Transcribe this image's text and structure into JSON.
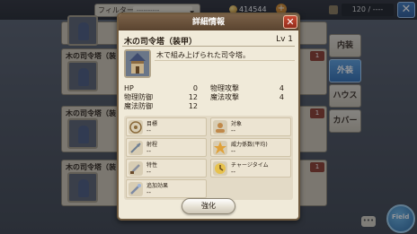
{
  "topbar": {
    "filter_label": "フィルター",
    "filter_value": "----------",
    "gold": "414544",
    "count": "120 / ----"
  },
  "list": {
    "items": [
      {
        "label": "",
        "num": ""
      },
      {
        "label": "木の司令塔（装",
        "num": "1"
      },
      {
        "label": "木の司令塔（装",
        "num": "1"
      },
      {
        "label": "木の司令塔（装",
        "num": "1"
      }
    ]
  },
  "side_tabs": [
    {
      "label": "内装",
      "active": false
    },
    {
      "label": "外装",
      "active": true
    },
    {
      "label": "ハウス",
      "active": false
    },
    {
      "label": "カバー",
      "active": false
    }
  ],
  "fab_label": "Field",
  "dialog": {
    "header": "詳細情報",
    "close": "✕",
    "item_name": "木の司令塔（装甲）",
    "level": "Lv 1",
    "description": "木で組み上げられた司令塔。",
    "stats": [
      {
        "k": "HP",
        "v": "0"
      },
      {
        "k": "物理攻撃",
        "v": "4"
      },
      {
        "k": "物理防御",
        "v": "12"
      },
      {
        "k": "魔法攻撃",
        "v": "4"
      },
      {
        "k": "魔法防御",
        "v": "12"
      }
    ],
    "attributes": [
      {
        "k": "目標",
        "v": "--",
        "icon": "target-icon"
      },
      {
        "k": "対象",
        "v": "--",
        "icon": "subject-icon"
      },
      {
        "k": "射程",
        "v": "--",
        "icon": "range-icon"
      },
      {
        "k": "威力係数(平均)",
        "v": "--",
        "icon": "power-icon"
      },
      {
        "k": "特性",
        "v": "--",
        "icon": "trait-icon"
      },
      {
        "k": "チャージタイム",
        "v": "--",
        "icon": "charge-icon"
      },
      {
        "k": "追加効果",
        "v": "--",
        "icon": "effect-icon"
      }
    ],
    "enhance_label": "強化"
  }
}
